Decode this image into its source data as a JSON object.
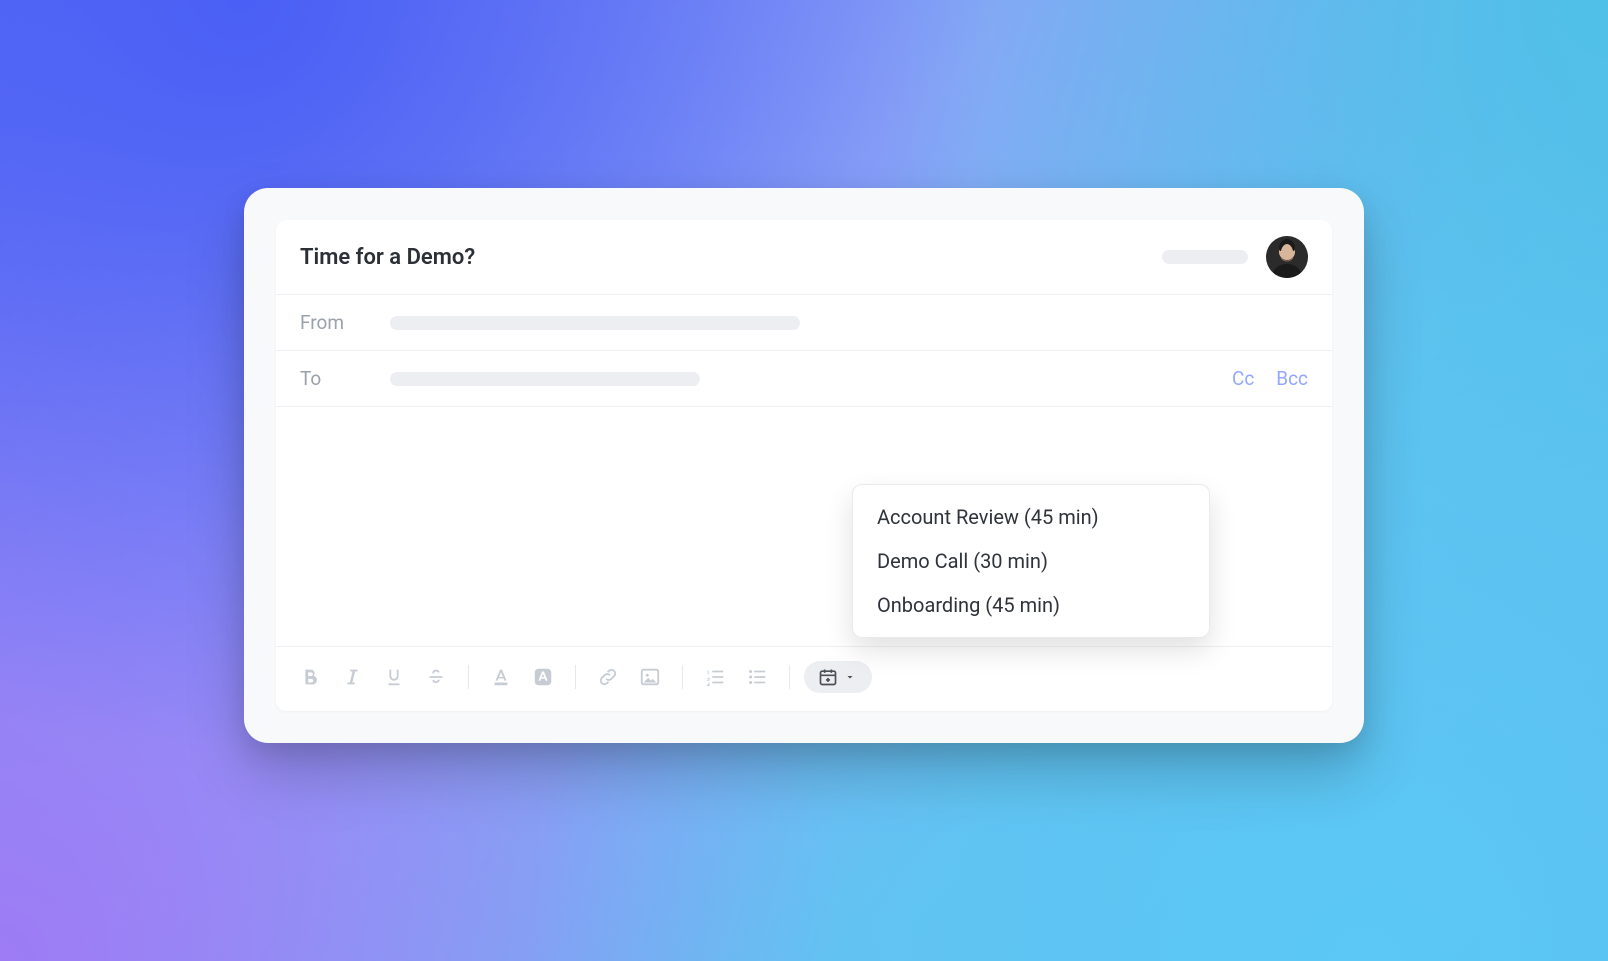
{
  "subject": "Time for a Demo?",
  "fields": {
    "from_label": "From",
    "to_label": "To",
    "cc_label": "Cc",
    "bcc_label": "Bcc"
  },
  "menu": {
    "items": [
      {
        "label": "Account Review (45 min)"
      },
      {
        "label": "Demo Call (30 min)"
      },
      {
        "label": "Onboarding (45 min)"
      }
    ]
  },
  "toolbar": {
    "buttons": [
      "bold",
      "italic",
      "underline",
      "strikethrough",
      "text-color",
      "background-color",
      "link",
      "image",
      "ordered-list",
      "unordered-list"
    ],
    "calendar_button": "insert-meeting"
  }
}
